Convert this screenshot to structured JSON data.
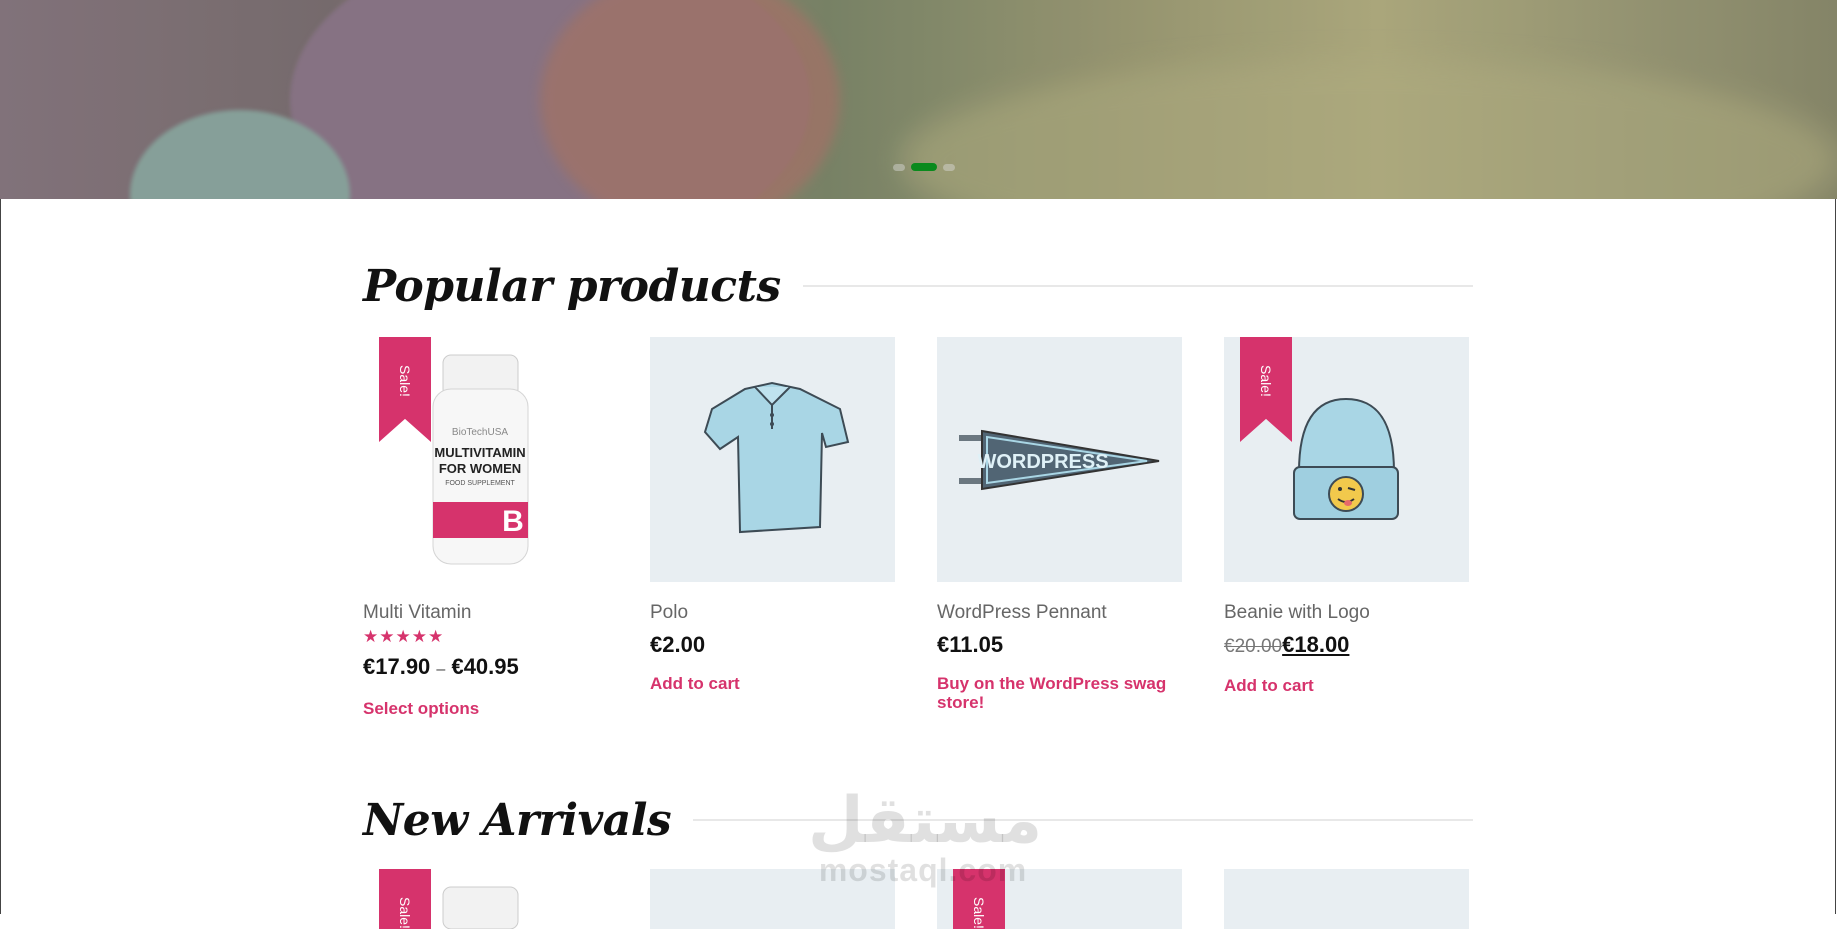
{
  "hero": {
    "slider_dots": 3,
    "active_dot": 2,
    "active_color": "#0a8a1d"
  },
  "popular": {
    "title": "Popular products",
    "products": [
      {
        "name": "Multi Vitamin",
        "badge": "Sale!",
        "rating_stars": "★★★★★",
        "rating_value": 5,
        "price_from": "€17.90",
        "price_sep": "–",
        "price_to": "€40.95",
        "action": "Select options",
        "image": "multivitamin-bottle-icon",
        "label_brand": "BioTechUSA",
        "label_line1": "MULTIVITAMIN",
        "label_line2": "FOR WOMEN",
        "label_line3": "FOOD SUPPLEMENT"
      },
      {
        "name": "Polo",
        "price": "€2.00",
        "action": "Add to cart",
        "image": "polo-shirt-icon"
      },
      {
        "name": "WordPress Pennant",
        "price": "€11.05",
        "action": "Buy on the WordPress swag store!",
        "image": "pennant-icon",
        "pennant_text": "WORDPRESS"
      },
      {
        "name": "Beanie with Logo",
        "badge": "Sale!",
        "price_old": "€20.00",
        "price_new": "€18.00",
        "action": "Add to cart",
        "image": "beanie-icon"
      }
    ]
  },
  "new_arrivals": {
    "title": "New Arrivals",
    "products": [
      {
        "badge": "Sale!",
        "image": "multivitamin-bottle-icon"
      },
      {
        "image": "product-placeholder"
      },
      {
        "badge": "Sale!",
        "image": "product-placeholder"
      },
      {
        "image": "product-placeholder"
      }
    ]
  },
  "watermark": {
    "arabic": "مستقل",
    "latin": "mostaql.com"
  },
  "colors": {
    "accent": "#d6336c",
    "thumb_bg": "#e8eef2"
  }
}
